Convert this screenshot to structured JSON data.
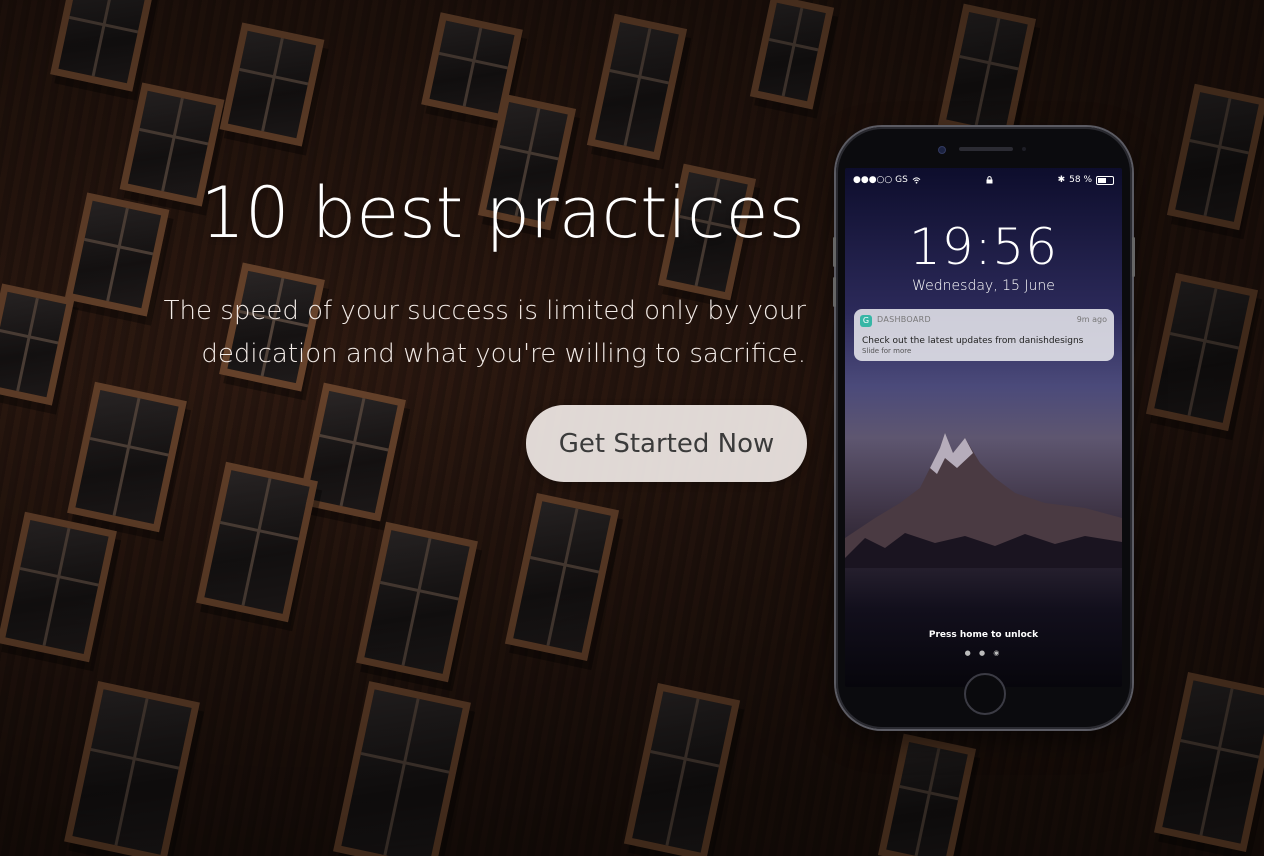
{
  "hero": {
    "title": "10 best practices",
    "subtitle_line1": "The speed of your success is limited only by your",
    "subtitle_line2": "dedication and what you're willing to sacrifice.",
    "cta_label": "Get Started Now"
  },
  "phone": {
    "status": {
      "carrier": "●●●○○ GS",
      "bluetooth": "✱",
      "battery_text": "58 %"
    },
    "time": "19:56",
    "date": "Wednesday, 15 June",
    "notification": {
      "app_icon": "G",
      "app": "DASHBOARD",
      "ago": "9m ago",
      "message": "Check out the latest updates from danishdesigns",
      "hint": "Slide for more"
    },
    "unlock_text": "Press home to unlock",
    "page_dots": "● ● ◉"
  },
  "colors": {
    "cta_bg": "#f5eeeb",
    "text": "#ffffff",
    "background_wood": "#3a2116",
    "notif_icon": "#37b6a6"
  },
  "icons": [
    "wifi-icon",
    "lock-icon",
    "bluetooth-icon",
    "battery-icon",
    "camera-icon",
    "home-button"
  ]
}
